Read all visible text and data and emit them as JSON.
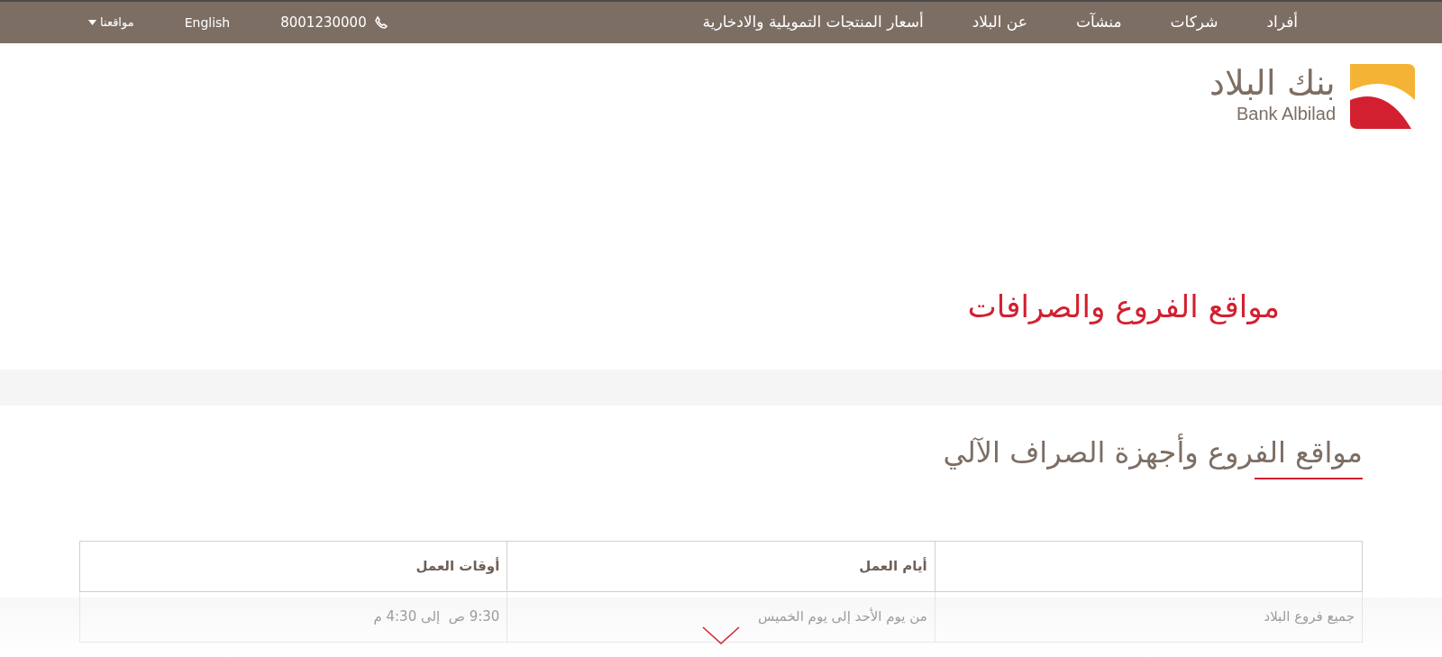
{
  "top_bar": {
    "nav": [
      "أفراد",
      "شركات",
      "منشآت",
      "عن البلاد",
      "أسعار المنتجات التمويلية والادخارية"
    ],
    "phone": "8001230000",
    "language": "English",
    "locations_menu": "مواقعنا"
  },
  "logo": {
    "arabic": "بنك البلاد",
    "english": "Bank Albilad"
  },
  "page_title": "مواقع الفروع والصرافات",
  "section_title": "مواقع الفروع وأجهزة الصراف الآلي",
  "table": {
    "columns": [
      "",
      "أيام العمل",
      "أوقات العمل"
    ],
    "rows": [
      [
        "جميع فروع البلاد",
        "من يوم الأحد إلى يوم الخميس",
        "9:30 ص  إلى 4:30 م"
      ]
    ]
  }
}
